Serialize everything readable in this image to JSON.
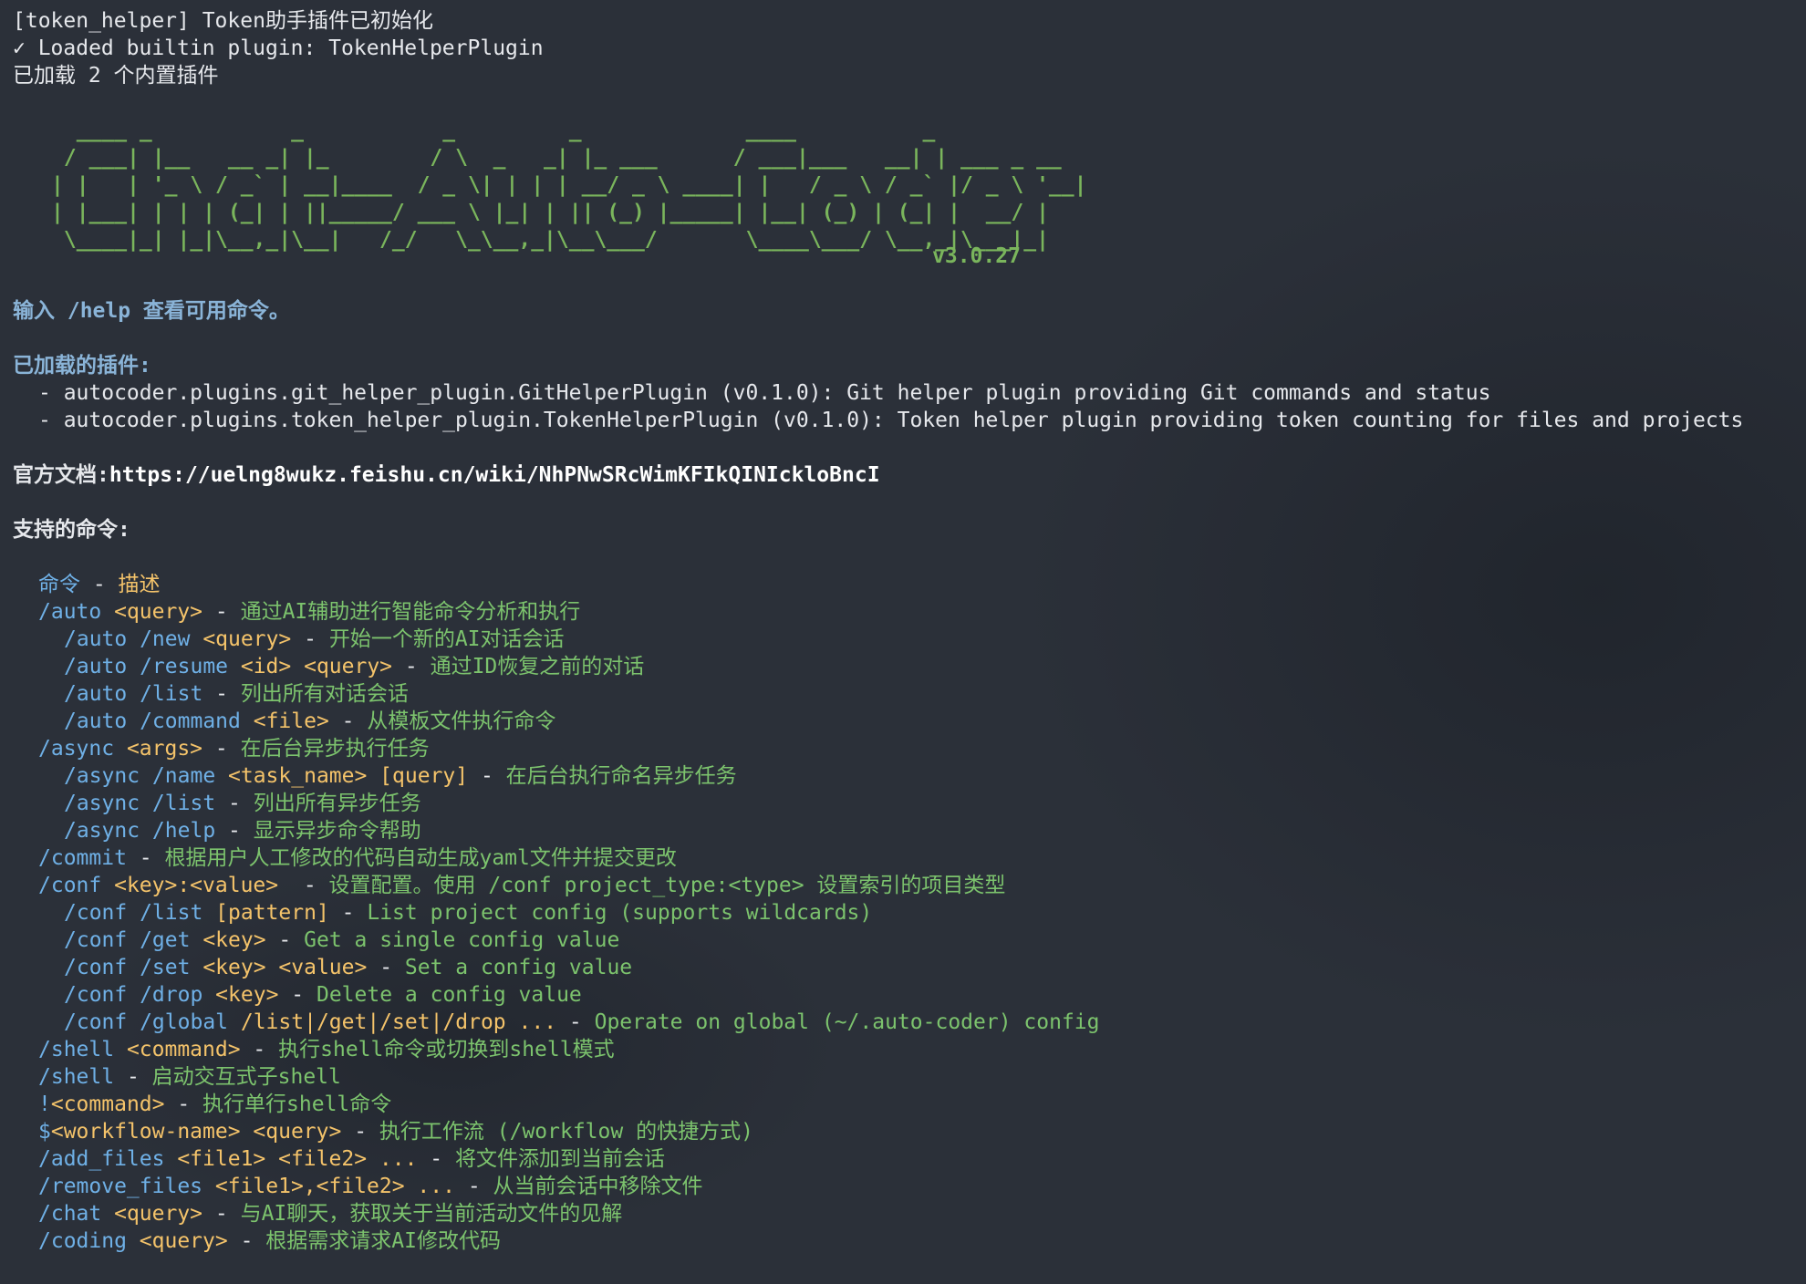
{
  "init_lines": [
    "[token_helper] Token助手插件已初始化",
    "✓ Loaded builtin plugin: TokenHelperPlugin",
    "已加载 2 个内置插件"
  ],
  "banner": {
    "ascii_lines": [
      "  ____ _           _           _         _             ____          _           ",
      " / ___| |__   __ _| |_        / \\  _   _| |_ ___      / ___|___   __| | ___ _ __ ",
      "| |   | '_ \\ / _` | __|____  / _ \\| | | | __/ _ \\ ____| |   / _ \\ / _` |/ _ \\ '__|",
      "| |___| | | | (_| | ||_____/ ___ \\ |_| | || (_) |_____| |__| (_) | (_| |  __/ |   ",
      " \\____|_| |_|\\__,_|\\__|   /_/   \\_\\__,_|\\__\\___/       \\____\\___/ \\__,_|\\___|_|   "
    ],
    "version": "v3.0.27"
  },
  "help_hint": "输入 /help 查看可用命令。",
  "plugins": {
    "heading": "已加载的插件:",
    "items": [
      "- autocoder.plugins.git_helper_plugin.GitHelperPlugin (v0.1.0): Git helper plugin providing Git commands and status",
      "- autocoder.plugins.token_helper_plugin.TokenHelperPlugin (v0.1.0): Token helper plugin providing token counting for files and projects"
    ]
  },
  "docs": {
    "label": "官方文档:",
    "url": "https://uelng8wukz.feishu.cn/wiki/NhPNwSRcWimKFIkQINIckloBncI"
  },
  "commands": {
    "heading": "支持的命令:",
    "header": {
      "cmd": "命令",
      "sep": " - ",
      "desc": "描述"
    },
    "rows": [
      {
        "indent": 1,
        "cmd": "/auto",
        "args": " <query>",
        "desc": "通过AI辅助进行智能命令分析和执行"
      },
      {
        "indent": 2,
        "cmd": "/auto /new",
        "args": " <query>",
        "desc": "开始一个新的AI对话会话"
      },
      {
        "indent": 2,
        "cmd": "/auto /resume",
        "args": " <id> <query>",
        "desc": "通过ID恢复之前的对话"
      },
      {
        "indent": 2,
        "cmd": "/auto /list",
        "args": "",
        "desc": "列出所有对话会话"
      },
      {
        "indent": 2,
        "cmd": "/auto /command",
        "args": " <file>",
        "desc": "从模板文件执行命令"
      },
      {
        "indent": 1,
        "cmd": "/async",
        "args": " <args>",
        "desc": "在后台异步执行任务"
      },
      {
        "indent": 2,
        "cmd": "/async /name",
        "args": " <task_name> [query]",
        "desc": "在后台执行命名异步任务"
      },
      {
        "indent": 2,
        "cmd": "/async /list",
        "args": "",
        "desc": "列出所有异步任务"
      },
      {
        "indent": 2,
        "cmd": "/async /help",
        "args": "",
        "desc": "显示异步命令帮助"
      },
      {
        "indent": 1,
        "cmd": "/commit",
        "args": "",
        "desc": "根据用户人工修改的代码自动生成yaml文件并提交更改"
      },
      {
        "indent": 1,
        "cmd": "/conf",
        "args": " <key>:<value> ",
        "desc": "设置配置。使用 /conf project_type:<type> 设置索引的项目类型"
      },
      {
        "indent": 2,
        "cmd": "/conf /list",
        "args": " [pattern]",
        "desc": "List project config (supports wildcards)"
      },
      {
        "indent": 2,
        "cmd": "/conf /get",
        "args": " <key>",
        "desc": "Get a single config value"
      },
      {
        "indent": 2,
        "cmd": "/conf /set",
        "args": " <key> <value>",
        "desc": "Set a config value"
      },
      {
        "indent": 2,
        "cmd": "/conf /drop",
        "args": " <key>",
        "desc": "Delete a config value"
      },
      {
        "indent": 2,
        "cmd": "/conf /global",
        "args": " /list|/get|/set|/drop ...",
        "desc": "Operate on global (~/.auto-coder) config"
      },
      {
        "indent": 1,
        "cmd": "/shell",
        "args": " <command>",
        "desc": "执行shell命令或切换到shell模式"
      },
      {
        "indent": 1,
        "cmd": "/shell",
        "args": "",
        "desc": "启动交互式子shell"
      },
      {
        "indent": 1,
        "cmd": "!",
        "args": "<command>",
        "desc": "执行单行shell命令"
      },
      {
        "indent": 1,
        "cmd": "$",
        "args": "<workflow-name> <query>",
        "desc": "执行工作流 (/workflow 的快捷方式)"
      },
      {
        "indent": 1,
        "cmd": "/add_files",
        "args": " <file1> <file2> ...",
        "desc": "将文件添加到当前会话"
      },
      {
        "indent": 1,
        "cmd": "/remove_files",
        "args": " <file1>,<file2> ...",
        "desc": "从当前会话中移除文件"
      },
      {
        "indent": 1,
        "cmd": "/chat",
        "args": " <query>",
        "desc": "与AI聊天，获取关于当前活动文件的见解"
      },
      {
        "indent": 1,
        "cmd": "/coding",
        "args": " <query>",
        "desc": "根据需求请求AI修改代码"
      }
    ]
  },
  "colors": {
    "background": "#2b3039",
    "command": "#6fb0e6",
    "argument": "#f4c36a",
    "description": "#7cc36d",
    "ascii_banner": "#7ab55c",
    "heading": "#8ab4d8"
  }
}
